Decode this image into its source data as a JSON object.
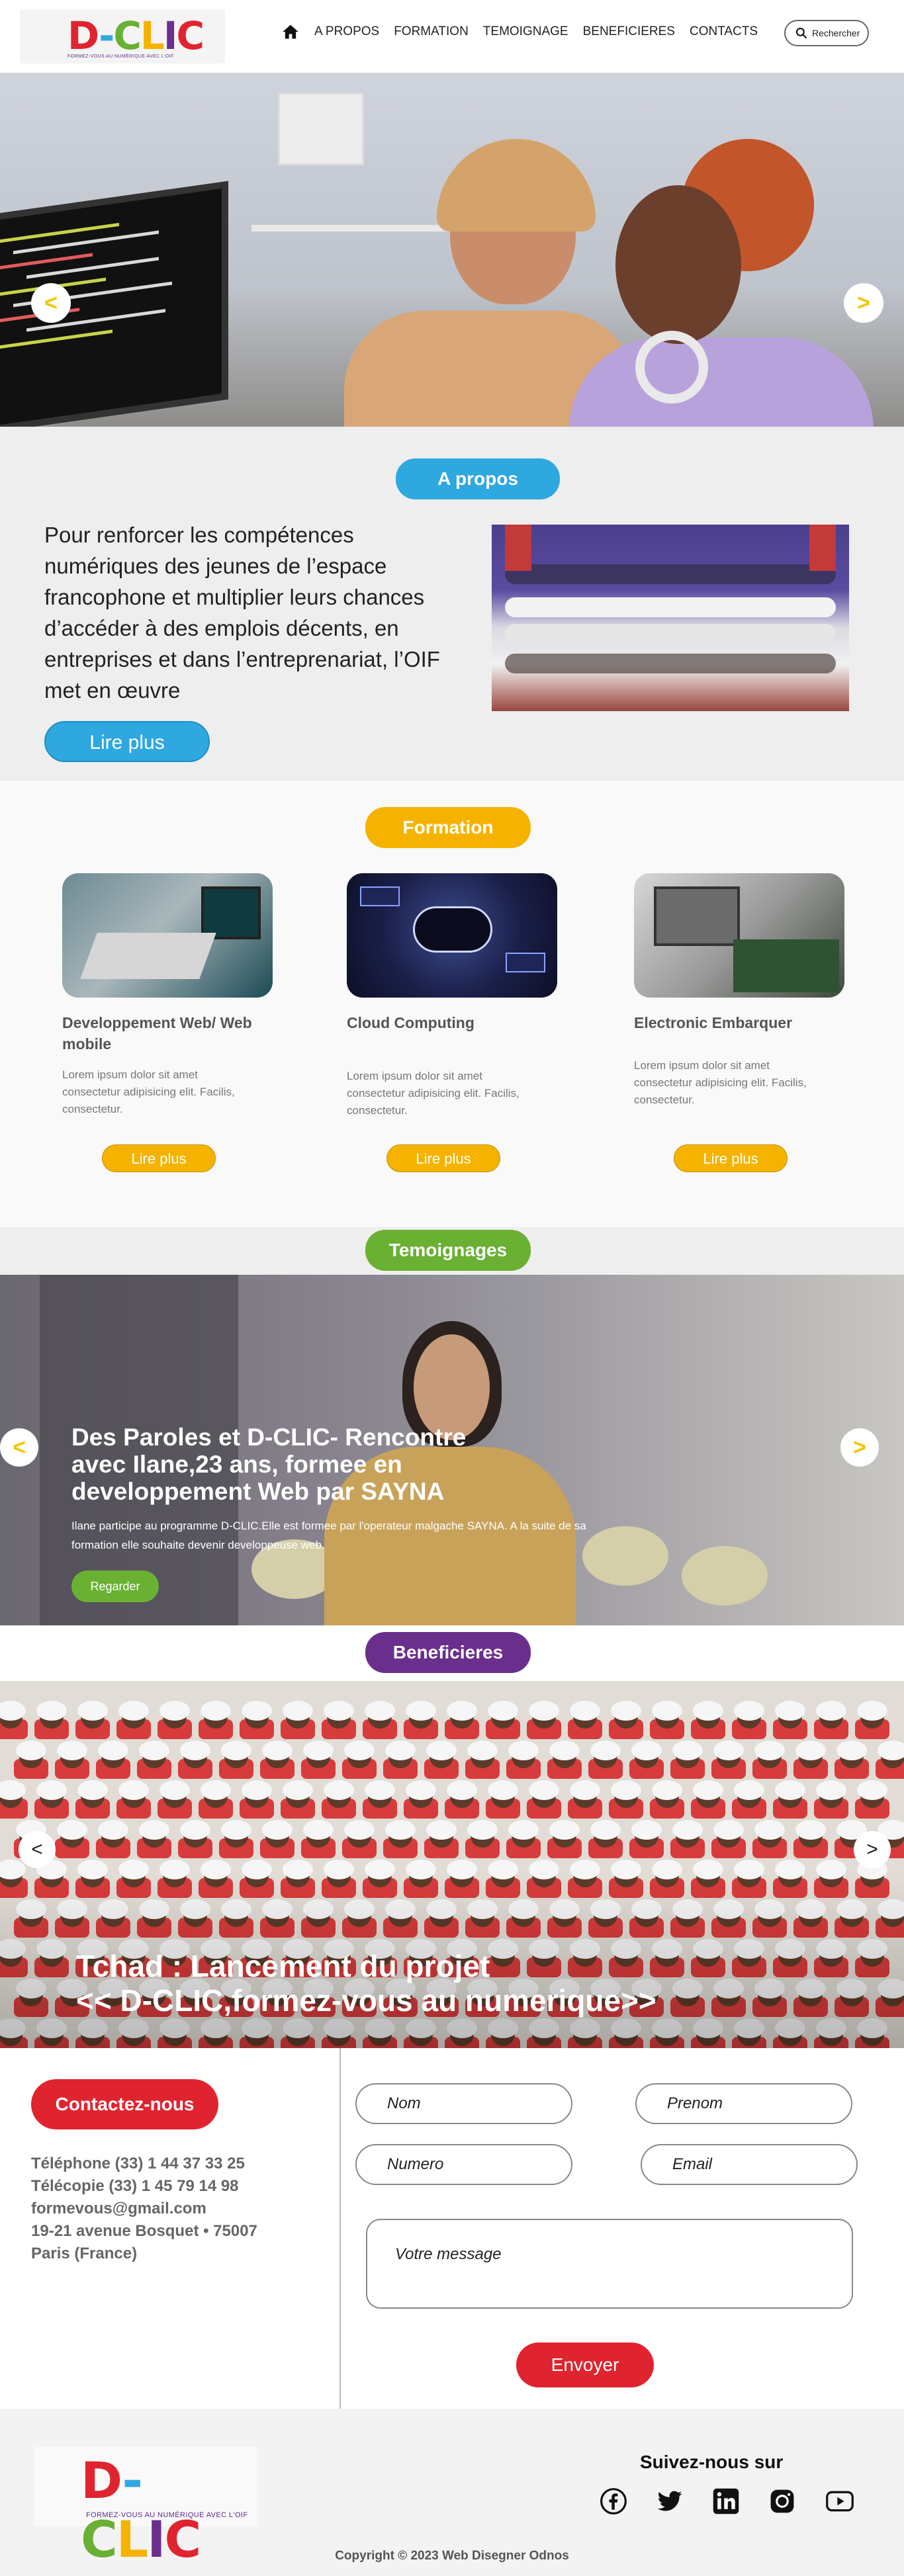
{
  "header": {
    "logo_text": "D-CLIC",
    "logo_tagline": "FORMEZ-VOUS AU NUMÉRIQUE AVEC L'OIF",
    "nav": [
      "A PROPOS",
      "FORMATION",
      "TEMOIGNAGE",
      "BENEFICIERES",
      "CONTACTS"
    ],
    "search_label": "Rechercher"
  },
  "hero": {
    "prev_symbol": "<",
    "next_symbol": ">"
  },
  "apropos": {
    "pill": "A propos",
    "text": "Pour renforcer les compétences numériques des jeunes de l’espace francophone et multiplier leurs chances d’accéder à des emplois décents, en entreprises et dans l’entreprenariat, l’OIF met en œuvre",
    "button": "Lire plus"
  },
  "formation": {
    "pill": "Formation",
    "cards": [
      {
        "title": "Developpement Web/ Web mobile",
        "text": "Lorem ipsum dolor sit amet consectetur adipisicing elit. Facilis, consectetur.",
        "button": "Lire plus"
      },
      {
        "title": "Cloud Computing",
        "text": "Lorem ipsum dolor sit amet consectetur adipisicing elit. Facilis, consectetur.",
        "button": "Lire plus"
      },
      {
        "title": "Electronic Embarquer",
        "text": "Lorem ipsum dolor sit amet consectetur adipisicing elit. Facilis, consectetur.",
        "button": "Lire plus"
      }
    ]
  },
  "temoignages": {
    "pill": "Temoignages",
    "title": "Des Paroles et D-CLIC- Rencontre avec Ilane,23 ans, formee en developpement Web par SAYNA",
    "description": "Ilane participe au programme D-CLIC.Elle est formee par l'operateur malgache SAYNA. A la suite de sa formation elle souhaite devenir developpeuse web.",
    "button": "Regarder",
    "prev_symbol": "<",
    "next_symbol": ">"
  },
  "beneficieres": {
    "pill": "Beneficieres",
    "title_line1": "Tchad : Lancement du projet",
    "title_line2": "<< D-CLIC,formez-vous au numerique>>",
    "prev_symbol": "<",
    "next_symbol": ">"
  },
  "contact": {
    "pill": "Contactez-nous",
    "phone": "Téléphone (33) 1 44 37 33 25",
    "fax": "Télécopie (33) 1 45 79 14 98",
    "email": "formevous@gmail.com",
    "address1": "19-21 avenue Bosquet • 75007",
    "address2": "Paris (France)",
    "fields": {
      "nom": "Nom",
      "prenom": "Prenom",
      "numero": "Numero",
      "email": "Email",
      "message": "Votre message"
    },
    "send": "Envoyer"
  },
  "footer": {
    "logo_text": "D-CLIC",
    "logo_tagline": "FORMEZ-VOUS AU NUMÉRIQUE AVEC L'OIF",
    "follow": "Suivez-nous sur",
    "socials": [
      "facebook-icon",
      "twitter-icon",
      "linkedin-icon",
      "instagram-icon",
      "youtube-icon"
    ],
    "copyright": "Copyright © 2023 Web Disegner Odnos"
  },
  "colors": {
    "blue": "#2ea8df",
    "yellow": "#f5b300",
    "green": "#6ab033",
    "purple": "#6a2f8c",
    "red": "#e0242f"
  }
}
